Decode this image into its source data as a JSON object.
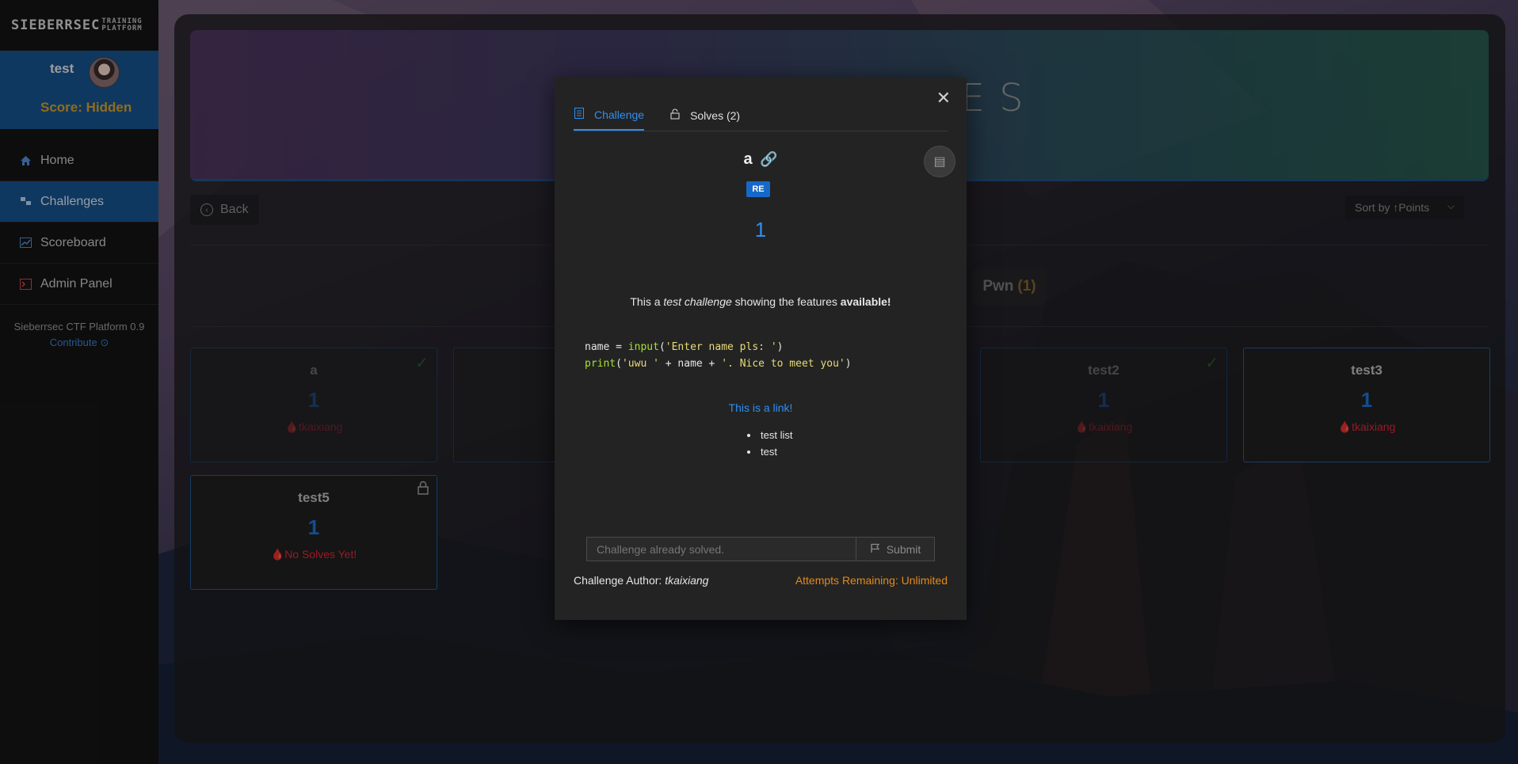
{
  "sidebar": {
    "logo_main": "SIEBERRSEC",
    "logo_sub_1": "TRAINING",
    "logo_sub_2": "PLATFORM",
    "username": "test",
    "score": "Score: Hidden",
    "nav": [
      {
        "label": "Home",
        "icon": "home-icon"
      },
      {
        "label": "Challenges",
        "icon": "challenges-icon"
      },
      {
        "label": "Scoreboard",
        "icon": "scoreboard-icon"
      },
      {
        "label": "Admin Panel",
        "icon": "terminal-icon"
      }
    ],
    "version": "Sieberrsec CTF Platform 0.9",
    "contribute": "Contribute"
  },
  "main": {
    "banner_title": "CHALLENGES",
    "back_label": "Back",
    "sort_label": "Sort by ↑Points",
    "category": {
      "name": "Pwn",
      "count": "(1)"
    },
    "cards": [
      {
        "title": "a",
        "points": "1",
        "solver": "tkaixiang",
        "solved": true
      },
      {
        "title": "test2",
        "points": "1",
        "solver": "tkaixiang",
        "solved": true
      },
      {
        "title": "test3",
        "points": "1",
        "solver": "tkaixiang",
        "solved": false
      },
      {
        "title": "test5",
        "points": "1",
        "solver": "No Solves Yet!",
        "locked": true
      }
    ]
  },
  "modal": {
    "tabs": [
      {
        "label": "Challenge",
        "icon": "document-icon"
      },
      {
        "label": "Solves (2)",
        "icon": "unlock-icon"
      }
    ],
    "title": "a",
    "tag": "RE",
    "points": "1",
    "description": {
      "pre": "This a ",
      "em": "test challenge",
      "mid": " showing the features ",
      "strong": "available!"
    },
    "code_line1_a": "name = ",
    "code_line1_fn": "input",
    "code_line1_b": "(",
    "code_line1_str": "'Enter name pls: '",
    "code_line1_c": ")",
    "code_line2_fn": "print",
    "code_line2_b": "(",
    "code_line2_str1": "'uwu '",
    "code_line2_mid": " + name + ",
    "code_line2_str2": "'. Nice to meet you'",
    "code_line2_c": ")",
    "link_text": "This is a link!",
    "list": [
      "test list",
      "test"
    ],
    "flag_placeholder": "Challenge already solved.",
    "submit_label": "Submit",
    "author_label": "Challenge Author: ",
    "author_name": "tkaixiang",
    "attempts": "Attempts Remaining: Unlimited"
  },
  "colors": {
    "accent": "#2f8ff0",
    "sidebar_active": "#17538f",
    "score": "#d4a02a",
    "attempts": "#e08a1e",
    "solver": "#e0263a"
  }
}
